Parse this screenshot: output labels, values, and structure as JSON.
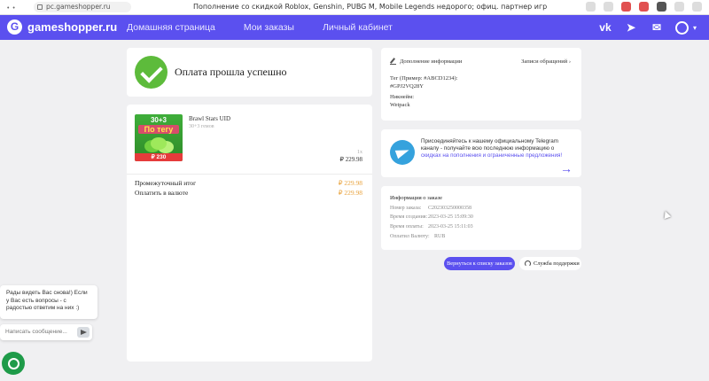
{
  "browser": {
    "url": "pc.gameshopper.ru",
    "tab_title": "Пополнение со скидкой Roblox, Genshin, PUBG M, Mobile Legends недорого; офиц. партнер игр"
  },
  "header": {
    "logo_letter": "G",
    "logo_text": "gameshopper.ru",
    "nav": [
      "Домашняя страница",
      "Мои заказы",
      "Личный кабинет"
    ],
    "icons": [
      "vk-icon",
      "telegram-icon",
      "mail-icon",
      "user-icon"
    ],
    "brand_color": "#5b50ef"
  },
  "success": {
    "label": "Оплата прошла успешно"
  },
  "order": {
    "product": {
      "image_top": "30+3",
      "image_banner": "По тегу",
      "image_price": "₽ 230",
      "name": "Brawl Stars UID",
      "desc": "30+3 гемов",
      "qty": "1x",
      "price": "₽ 229.98"
    },
    "subtotal_label": "Промежуточный итог",
    "subtotal_value": "₽ 229.98",
    "pay_label": "Оплатить в валюте",
    "pay_value": "₽ 229.98"
  },
  "additional": {
    "title": "Дополнение информации",
    "log_link": "Записи обращений",
    "tag_label": "Тег (Пример: #ABCD1234):",
    "tag_value": "#GPJ2VQ28Y",
    "nick_label": "Никнейм:",
    "nick_value": "Wetpack"
  },
  "telegram": {
    "text_main": "Присоединяйтесь к нашему официальному Telegram каналу - получайте всю последнюю информацию о ",
    "text_highlight": "скидках на пополнения и ограниченные предложения!",
    "arrow": "→"
  },
  "order_info": {
    "title": "Информация о заказе",
    "rows": [
      {
        "k": "Номер заказа:",
        "v": "C202303250000358"
      },
      {
        "k": "Время создания:",
        "v": "2023-03-25 15:09:30"
      },
      {
        "k": "Время оплаты:",
        "v": "2023-03-25 15:11:03"
      },
      {
        "k": "Оплатил Валюту:",
        "v": "RUB"
      }
    ]
  },
  "buttons": {
    "back": "Вернуться к списку заказов",
    "support": "Служба поддержки"
  },
  "chat": {
    "message": "Рады видеть Вас снова!) Если у Вас есть вопросы - с радостью ответим на них :)",
    "placeholder": "Написать сообщение..."
  }
}
